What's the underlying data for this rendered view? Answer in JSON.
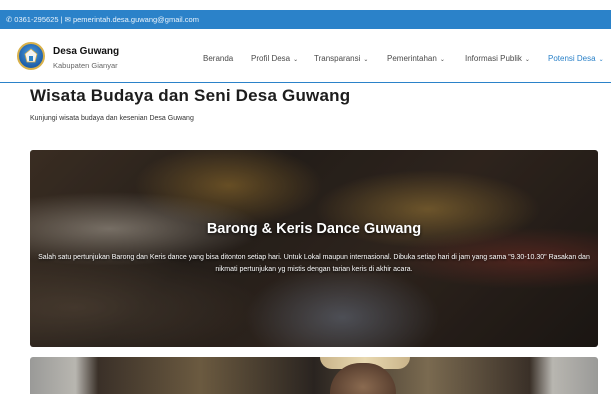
{
  "topbar": {
    "phone_icon": "phone-icon",
    "phone": "0361-295625",
    "separator": "|",
    "email_icon": "mail-icon",
    "email": "pemerintah.desa.guwang@gmail.com"
  },
  "brand": {
    "name": "Desa Guwang",
    "subtitle": "Kabupaten Gianyar",
    "logo_icon": "village-emblem-icon"
  },
  "nav": {
    "items": [
      {
        "label": "Beranda",
        "has_dropdown": false
      },
      {
        "label": "Profil Desa",
        "has_dropdown": true
      },
      {
        "label": "Transparansi",
        "has_dropdown": true
      },
      {
        "label": "Pemerintahan",
        "has_dropdown": true
      },
      {
        "label": "Informasi Publik",
        "has_dropdown": true
      },
      {
        "label": "Potensi Desa",
        "has_dropdown": true,
        "active": true
      }
    ],
    "chevron": "⌄"
  },
  "page": {
    "title": "Wisata Budaya dan Seni Desa Guwang",
    "subtitle": "Kunjungi wisata budaya dan kesenian Desa Guwang"
  },
  "cards": [
    {
      "title": "Barong & Keris Dance Guwang",
      "description": "Salah satu pertunjukan Barong dan Keris dance yang bisa ditonton setiap hari. Untuk Lokal maupun internasional. Dibuka setiap hari di jam yang sama \"9.30-10.30\" Rasakan dan nikmati pertunjukan yg mistis dengan tarian keris di akhir acara."
    },
    {
      "title": "",
      "description": ""
    }
  ],
  "colors": {
    "accent": "#2b82c9",
    "active_menu": "#2b82c9",
    "title_text": "#1d1d1d"
  }
}
